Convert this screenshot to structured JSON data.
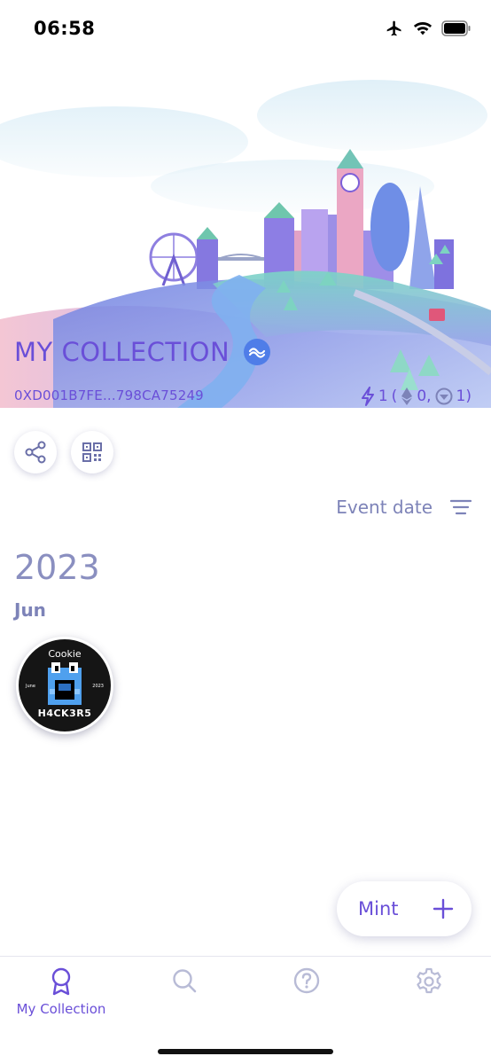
{
  "status_bar": {
    "time": "06:58",
    "icons": [
      "airplane-icon",
      "wifi-icon",
      "battery-icon"
    ]
  },
  "header": {
    "title": "MY COLLECTION",
    "address": "0XD001B7FE...798CA75249",
    "stats": {
      "total": "1",
      "open": "(",
      "eth": "0,",
      "gnosis": "1)"
    }
  },
  "sort": {
    "label": "Event date"
  },
  "collection": {
    "year": "2023",
    "month": "Jun",
    "badges": [
      {
        "top_text": "Cookie",
        "left_text": "June",
        "right_text": "2023",
        "bottom_text": "H4CK3R5"
      }
    ]
  },
  "mint": {
    "label": "Mint"
  },
  "tabs": [
    {
      "label": "My Collection",
      "icon": "award-icon",
      "active": true
    },
    {
      "label": "",
      "icon": "search-icon",
      "active": false
    },
    {
      "label": "",
      "icon": "help-icon",
      "active": false
    },
    {
      "label": "",
      "icon": "gear-icon",
      "active": false
    }
  ],
  "colors": {
    "accent": "#6a4fd8",
    "muted": "#7d83b8",
    "badge_blue": "#4f7de8"
  }
}
